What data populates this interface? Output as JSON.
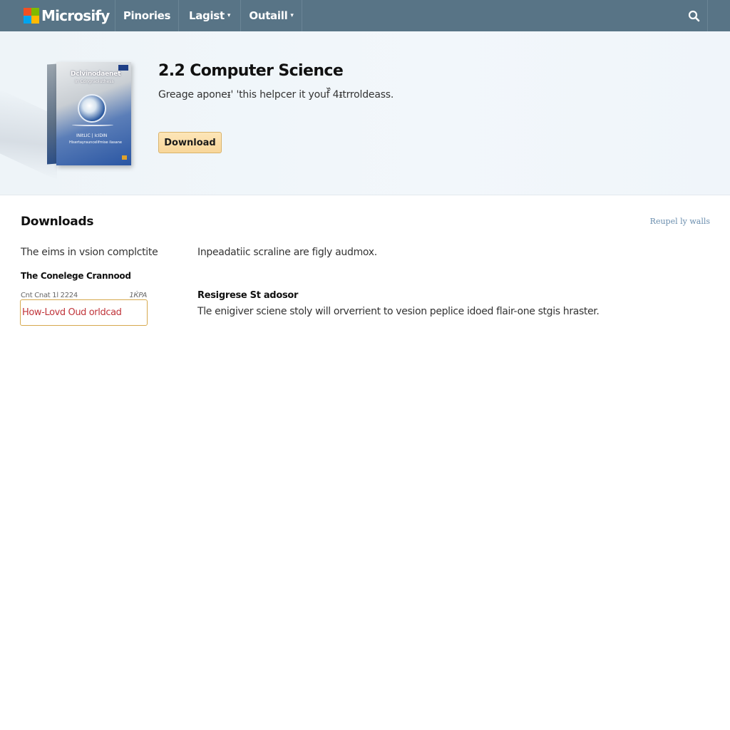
{
  "nav": {
    "brand": "Microsify",
    "logo_colors": [
      "#f25022",
      "#7fba00",
      "#00a4ef",
      "#ffb900"
    ],
    "items": [
      {
        "label": "Pinories",
        "has_dropdown": false
      },
      {
        "label": "Lagist",
        "has_dropdown": true
      },
      {
        "label": "Outaill",
        "has_dropdown": true
      }
    ],
    "caret": "▾",
    "search_icon": "search-icon"
  },
  "hero": {
    "box": {
      "title": "Dclvinodaenet",
      "subtitle": "In Cdngraoluthess",
      "caption": "INItLIC | IcIDIN",
      "caption2": "Hisertayrauncelifmise ilasane"
    },
    "title": "2.2 Computer Science",
    "description": "Greage aponeᵻ' 'this helpcer it youf᷈ 4ᵻtrroldeass.",
    "download_label": "Download",
    "accent_color": "#f8d69a"
  },
  "downloads": {
    "title": "Downloads",
    "link": "Reupel ly walls",
    "left": {
      "description": "The eims in vsion complctite",
      "subtitle": "The Conelege Crannood",
      "meta_date": "Cnt Cnat 1l 2224",
      "meta_size": "1ЌPA",
      "link_label": "How-Lovd Oud orldcad",
      "link_color": "#c0343a"
    },
    "right": {
      "description": "Inpeadatiic scraline are figly audmox.",
      "subtitle": "Resigrese St adosor",
      "body": "Tle enigiver sciene stoly will orverrient to vesion peplice idoed flair-one stgis hraster."
    }
  }
}
